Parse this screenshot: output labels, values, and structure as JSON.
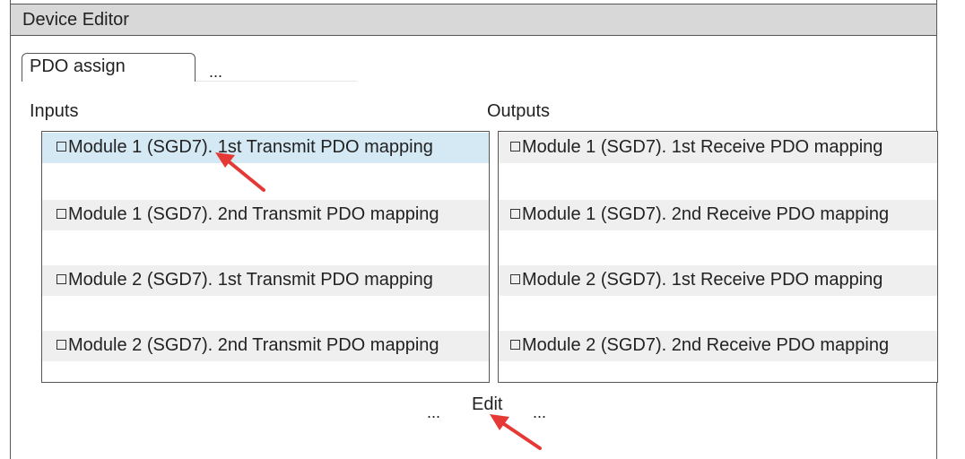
{
  "window": {
    "title": "Device Editor"
  },
  "tabs": {
    "active_label": "PDO assign",
    "more_label": "..."
  },
  "inputs": {
    "label": "Inputs",
    "items": [
      "Module 1 (SGD7). 1st Transmit PDO mapping",
      "Module 1 (SGD7). 2nd Transmit PDO mapping",
      "Module 2 (SGD7). 1st Transmit PDO mapping",
      "Module 2 (SGD7). 2nd Transmit PDO mapping"
    ]
  },
  "outputs": {
    "label": "Outputs",
    "items": [
      "Module 1 (SGD7). 1st Receive PDO mapping",
      "Module 1 (SGD7). 2nd Receive PDO mapping",
      "Module 2 (SGD7). 1st Receive PDO mapping",
      "Module 2 (SGD7). 2nd Receive PDO mapping"
    ]
  },
  "footer": {
    "left_more": "...",
    "edit_label": "Edit",
    "right_more": "..."
  },
  "colors": {
    "annotation_arrow": "#e53935",
    "selection": "#d5e9f4",
    "titlebar": "#d8d8d8"
  }
}
